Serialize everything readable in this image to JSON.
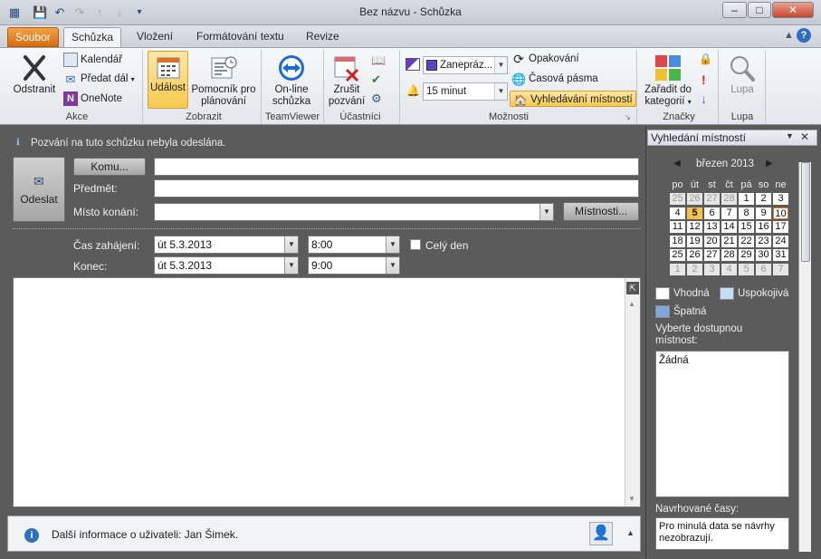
{
  "window": {
    "title": "Bez názvu - Schůzka"
  },
  "tabs": [
    "Soubor",
    "Schůzka",
    "Vložení",
    "Formátování textu",
    "Revize"
  ],
  "ribbon": {
    "akce": {
      "label": "Akce",
      "delete": "Odstranit",
      "calendar": "Kalendář",
      "forward": "Předat dál",
      "onenote": "OneNote"
    },
    "zobrazit": {
      "label": "Zobrazit",
      "event": "Událost",
      "assistant_l1": "Pomocník pro",
      "assistant_l2": "plánování"
    },
    "teamviewer": {
      "label": "TeamViewer",
      "online_l1": "On-line",
      "online_l2": "schůzka"
    },
    "ucastnici": {
      "label": "Účastníci",
      "cancel_l1": "Zrušit",
      "cancel_l2": "pozvání"
    },
    "moznosti": {
      "label": "Možnosti",
      "busy": "Zanepráz...",
      "reminder": "15 minut",
      "recurrence": "Opakování",
      "timezones": "Časová pásma",
      "room_finder": "Vyhledávání místností"
    },
    "znacky": {
      "label": "Značky",
      "categorize_l1": "Zařadit do",
      "categorize_l2": "kategorií"
    },
    "lupa": {
      "label": "Lupa",
      "zoom": "Lupa"
    }
  },
  "form": {
    "notice": "Pozvání na tuto schůzku nebyla odeslána.",
    "send": "Odeslat",
    "to_button": "Komu...",
    "subject_label": "Předmět:",
    "location_label": "Místo konání:",
    "rooms_button": "Místnosti...",
    "start_label": "Čas zahájení:",
    "end_label": "Konec:",
    "start_date": "út 5.3.2013",
    "start_time": "8:00",
    "end_date": "út 5.3.2013",
    "end_time": "9:00",
    "all_day": "Celý den",
    "to_value": "",
    "subject_value": "",
    "location_value": ""
  },
  "statusbar": {
    "info": "Další informace o uživateli: Jan Šimek."
  },
  "room_finder": {
    "title": "Vyhledání místností",
    "month": "březen 2013",
    "weekdays": [
      "po",
      "út",
      "st",
      "čt",
      "pá",
      "so",
      "ne"
    ],
    "weeks": [
      [
        "25",
        "26",
        "27",
        "28",
        "1",
        "2",
        "3"
      ],
      [
        "4",
        "5",
        "6",
        "7",
        "8",
        "9",
        "10"
      ],
      [
        "11",
        "12",
        "13",
        "14",
        "15",
        "16",
        "17"
      ],
      [
        "18",
        "19",
        "20",
        "21",
        "22",
        "23",
        "24"
      ],
      [
        "25",
        "26",
        "27",
        "28",
        "29",
        "30",
        "31"
      ],
      [
        "1",
        "2",
        "3",
        "4",
        "5",
        "6",
        "7"
      ]
    ],
    "legend_good": "Vhodná",
    "legend_fair": "Uspokojivá",
    "legend_poor": "Špatná",
    "choose_label_l1": "Vyberte dostupnou",
    "choose_label_l2": "místnost:",
    "rooms_list": "Žádná",
    "suggested_label": "Navrhované časy:",
    "suggested_text_l1": "Pro minulá data se návrhy",
    "suggested_text_l2": "nezobrazují."
  },
  "colors": {
    "accent_orange": "#e07a1f",
    "selected_day": "#f7c24a",
    "today_border": "#e07a1f"
  }
}
